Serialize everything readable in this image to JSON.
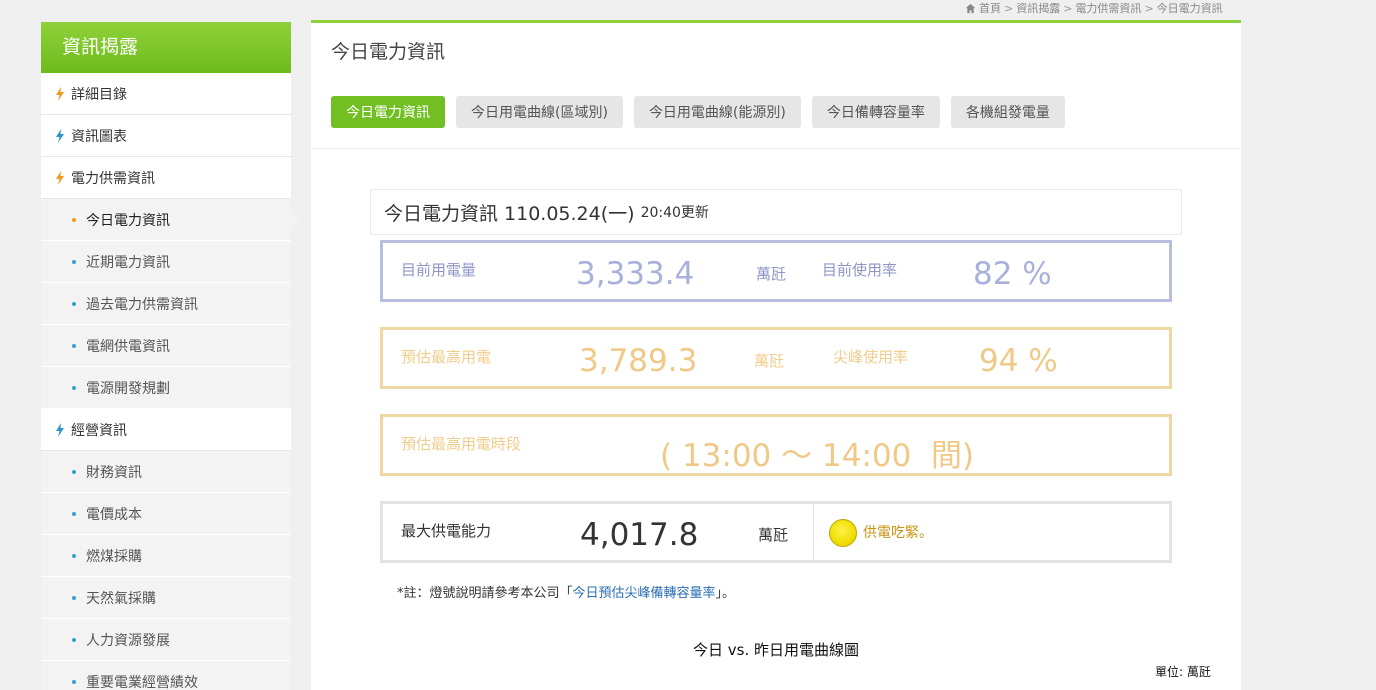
{
  "breadcrumb": {
    "items": [
      "首頁",
      "資訊揭露",
      "電力供需資訊",
      "今日電力資訊"
    ]
  },
  "sidebar": {
    "title": "資訊揭露",
    "items": [
      {
        "label": "詳細目錄",
        "type": "section"
      },
      {
        "label": "資訊圖表",
        "type": "section"
      },
      {
        "label": "電力供需資訊",
        "type": "section"
      },
      {
        "label": "今日電力資訊",
        "type": "sub",
        "active": true
      },
      {
        "label": "近期電力資訊",
        "type": "sub"
      },
      {
        "label": "過去電力供需資訊",
        "type": "sub"
      },
      {
        "label": "電網供電資訊",
        "type": "sub"
      },
      {
        "label": "電源開發規劃",
        "type": "sub"
      },
      {
        "label": "經營資訊",
        "type": "section"
      },
      {
        "label": "財務資訊",
        "type": "sub"
      },
      {
        "label": "電價成本",
        "type": "sub"
      },
      {
        "label": "燃煤採購",
        "type": "sub"
      },
      {
        "label": "天然氣採購",
        "type": "sub"
      },
      {
        "label": "人力資源發展",
        "type": "sub"
      },
      {
        "label": "重要電業經營績效",
        "type": "sub"
      }
    ]
  },
  "main": {
    "title": "今日電力資訊",
    "tabs": [
      {
        "label": "今日電力資訊",
        "active": true
      },
      {
        "label": "今日用電曲線(區域別)"
      },
      {
        "label": "今日用電曲線(能源別)"
      },
      {
        "label": "今日備轉容量率"
      },
      {
        "label": "各機組發電量"
      }
    ],
    "info_header": {
      "title": "今日電力資訊 110.05.24(一)",
      "updated": "20:40更新"
    },
    "current": {
      "usage_label": "目前用電量",
      "usage_value": "3,333.4",
      "usage_unit": "萬瓩",
      "rate_label": "目前使用率",
      "rate_value": "82 %"
    },
    "forecast": {
      "peak_label": "預估最高用電",
      "peak_value": "3,789.3",
      "peak_unit": "萬瓩",
      "peak_rate_label": "尖峰使用率",
      "peak_rate_value": "94 %"
    },
    "peak_period": {
      "label": "預估最高用電時段",
      "value": "( 13:00 ～ 14:00  間)"
    },
    "supply": {
      "label": "最大供電能力",
      "value": "4,017.8",
      "unit": "萬瓩",
      "status_text": "供電吃緊。",
      "status_color": "#f0dd00"
    },
    "note": {
      "prefix": "*註：燈號說明請參考本公司「",
      "link": "今日預估尖峰備轉容量率",
      "suffix": "」。"
    },
    "chart": {
      "title": "今日 vs. 昨日用電曲線圖",
      "unit": "單位: 萬瓩"
    }
  },
  "colors": {
    "accent_green": "#72bf24",
    "link_blue": "#2a6fb4",
    "current_box": "#b8bedd",
    "forecast_box": "#f0d6a0"
  }
}
